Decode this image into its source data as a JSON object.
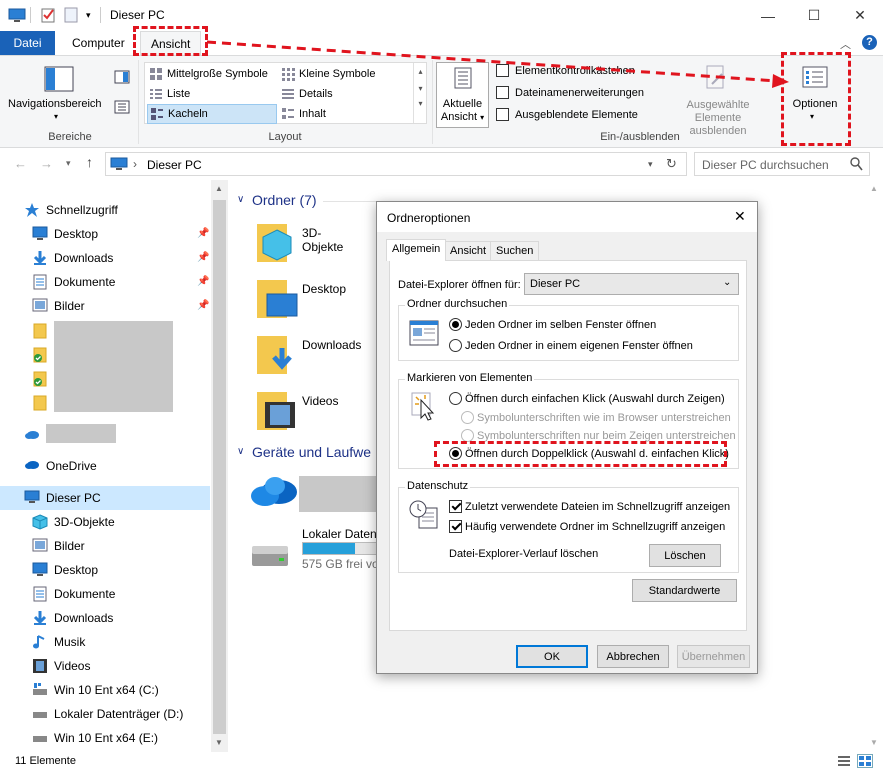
{
  "window": {
    "title": "Dieser PC"
  },
  "tabs": {
    "datei": "Datei",
    "computer": "Computer",
    "ansicht": "Ansicht"
  },
  "ribbon": {
    "navpane": "Navigationsbereich",
    "bereiche": "Bereiche",
    "layout_items": [
      "Mittelgroße Symbole",
      "Kleine Symbole",
      "Liste",
      "Details",
      "Kacheln",
      "Inhalt"
    ],
    "layout_label": "Layout",
    "current_view_l1": "Aktuelle",
    "current_view_l2": "Ansicht",
    "checks": [
      "Elementkontrollkästchen",
      "Dateinamenerweiterungen",
      "Ausgeblendete Elemente"
    ],
    "hide_sel_l1": "Ausgewählte",
    "hide_sel_l2": "Elemente ausblenden",
    "show_hide_label": "Ein-/ausblenden",
    "options": "Optionen"
  },
  "address": {
    "path": "Dieser PC",
    "search_placeholder": "Dieser PC durchsuchen"
  },
  "nav": {
    "quick": "Schnellzugriff",
    "quick_items": [
      "Desktop",
      "Downloads",
      "Dokumente",
      "Bilder"
    ],
    "onedrive": "OneDrive",
    "thispc": "Dieser PC",
    "pc_items": [
      "3D-Objekte",
      "Bilder",
      "Desktop",
      "Dokumente",
      "Downloads",
      "Musik",
      "Videos",
      "Win 10 Ent x64 (C:)",
      "Lokaler Datenträger (D:)",
      "Win 10 Ent x64 (E:)"
    ]
  },
  "content": {
    "folders_header": "Ordner (7)",
    "folders": [
      "3D-Objekte",
      "Desktop",
      "Downloads",
      "Videos"
    ],
    "devices_header": "Geräte und Laufwe",
    "drive_name": "Lokaler Datent",
    "drive_free": "575 GB frei vo",
    "drive_fill_fraction": 0.7
  },
  "status": {
    "count": "11 Elemente"
  },
  "dialog": {
    "title": "Ordneroptionen",
    "tabs": [
      "Allgemein",
      "Ansicht",
      "Suchen"
    ],
    "open_label": "Datei-Explorer öffnen für:",
    "open_value": "Dieser PC",
    "browse_group": "Ordner durchsuchen",
    "browse_opts": [
      "Jeden Ordner im selben Fenster öffnen",
      "Jeden Ordner in einem eigenen Fenster öffnen"
    ],
    "click_group": "Markieren von Elementen",
    "click_opts": [
      "Öffnen durch einfachen Klick (Auswahl durch Zeigen)",
      "Symbolunterschriften wie im Browser unterstreichen",
      "Symbolunterschriften nur beim Zeigen unterstreichen",
      "Öffnen durch Doppelklick (Auswahl d. einfachen Klick)"
    ],
    "privacy_group": "Datenschutz",
    "privacy_opts": [
      "Zuletzt verwendete Dateien im Schnellzugriff anzeigen",
      "Häufig verwendete Ordner im Schnellzugriff anzeigen"
    ],
    "history_label": "Datei-Explorer-Verlauf löschen",
    "clear_btn": "Löschen",
    "defaults_btn": "Standardwerte",
    "ok": "OK",
    "cancel": "Abbrechen",
    "apply": "Übernehmen"
  },
  "colors": {
    "accent": "#1a62b8",
    "highlight": "#e0141e",
    "folder": "#f3c84e"
  }
}
